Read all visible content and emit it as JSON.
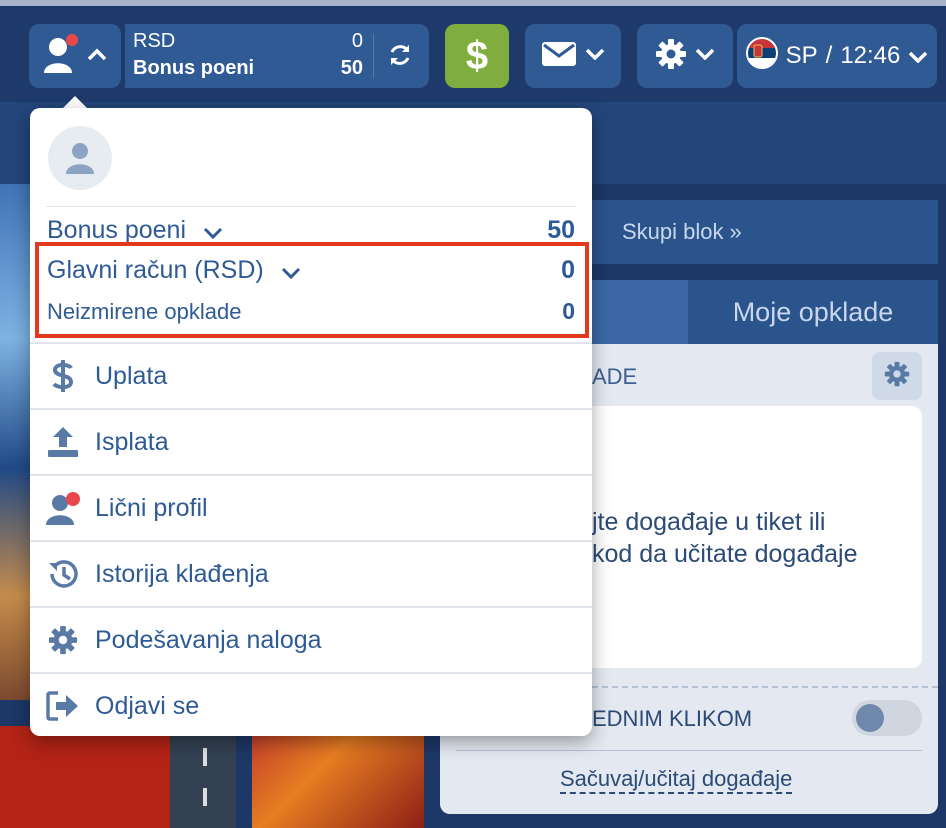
{
  "header": {
    "currency": "RSD",
    "currency_balance": "0",
    "bonus_label": "Bonus poeni",
    "bonus_value": "50",
    "deposit_symbol": "$",
    "language": "SP",
    "separator": "/",
    "time": "12:46"
  },
  "right_panel": {
    "collapse_label": "Skupi blok",
    "collapse_icon": "»",
    "tab_my_bets": "Moje opklade",
    "slip_title_partial": "ADE",
    "slip_message_line1": "jte događaje u tiket ili",
    "slip_message_line2": "kod da učitate događaje",
    "one_click_partial": "EDNIM KLIKOM",
    "save_load_link": "Sačuvaj/učitaj događaje"
  },
  "dropdown": {
    "bonus_label": "Bonus poeni",
    "bonus_value": "50",
    "main_account_label": "Glavni račun (RSD)",
    "main_account_value": "0",
    "unsettled_label": "Neizmirene opklade",
    "unsettled_value": "0",
    "menu": [
      {
        "label": "Uplata",
        "icon": "dollar-icon"
      },
      {
        "label": "Isplata",
        "icon": "upload-icon"
      },
      {
        "label": "Lični profil",
        "icon": "user-icon"
      },
      {
        "label": "Istorija klađenja",
        "icon": "history-icon"
      },
      {
        "label": "Podešavanja naloga",
        "icon": "gear-icon"
      },
      {
        "label": "Odjavi se",
        "icon": "logout-icon"
      }
    ]
  },
  "colors": {
    "header_bg": "#1d3a6b",
    "button_bg": "#2f5a93",
    "deposit_green": "#7fad3e",
    "highlight_red": "#e2381c",
    "menu_text": "#2e5b95",
    "notification_dot": "#e8474c"
  }
}
